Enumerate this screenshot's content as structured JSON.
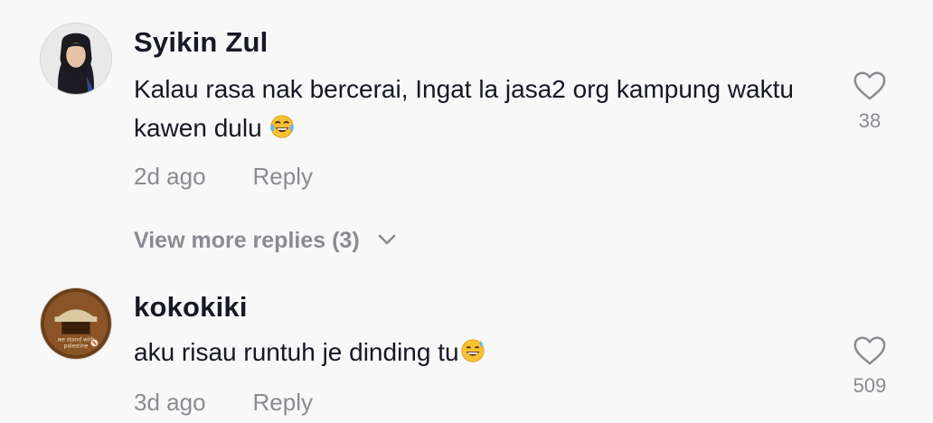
{
  "comments": [
    {
      "username": "Syikin Zul",
      "text": "Kalau rasa nak bercerai, Ingat la jasa2 org kampung waktu kawen dulu",
      "emoji_icon": "tears-of-joy-emoji",
      "time": "2d ago",
      "reply_label": "Reply",
      "likes": "38"
    },
    {
      "username": "kokokiki",
      "text": "aku risau runtuh je dinding tu",
      "emoji_icon": "grinning-sweat-emoji",
      "avatar_text": [
        "we stand with",
        "palestine"
      ],
      "time": "3d ago",
      "reply_label": "Reply",
      "likes": "509"
    }
  ],
  "view_more": {
    "label": "View more replies (3)",
    "icon": "chevron-down-icon"
  },
  "colors": {
    "text": "#161823",
    "muted": "#8a8b91",
    "background": "#f8f8f8"
  }
}
